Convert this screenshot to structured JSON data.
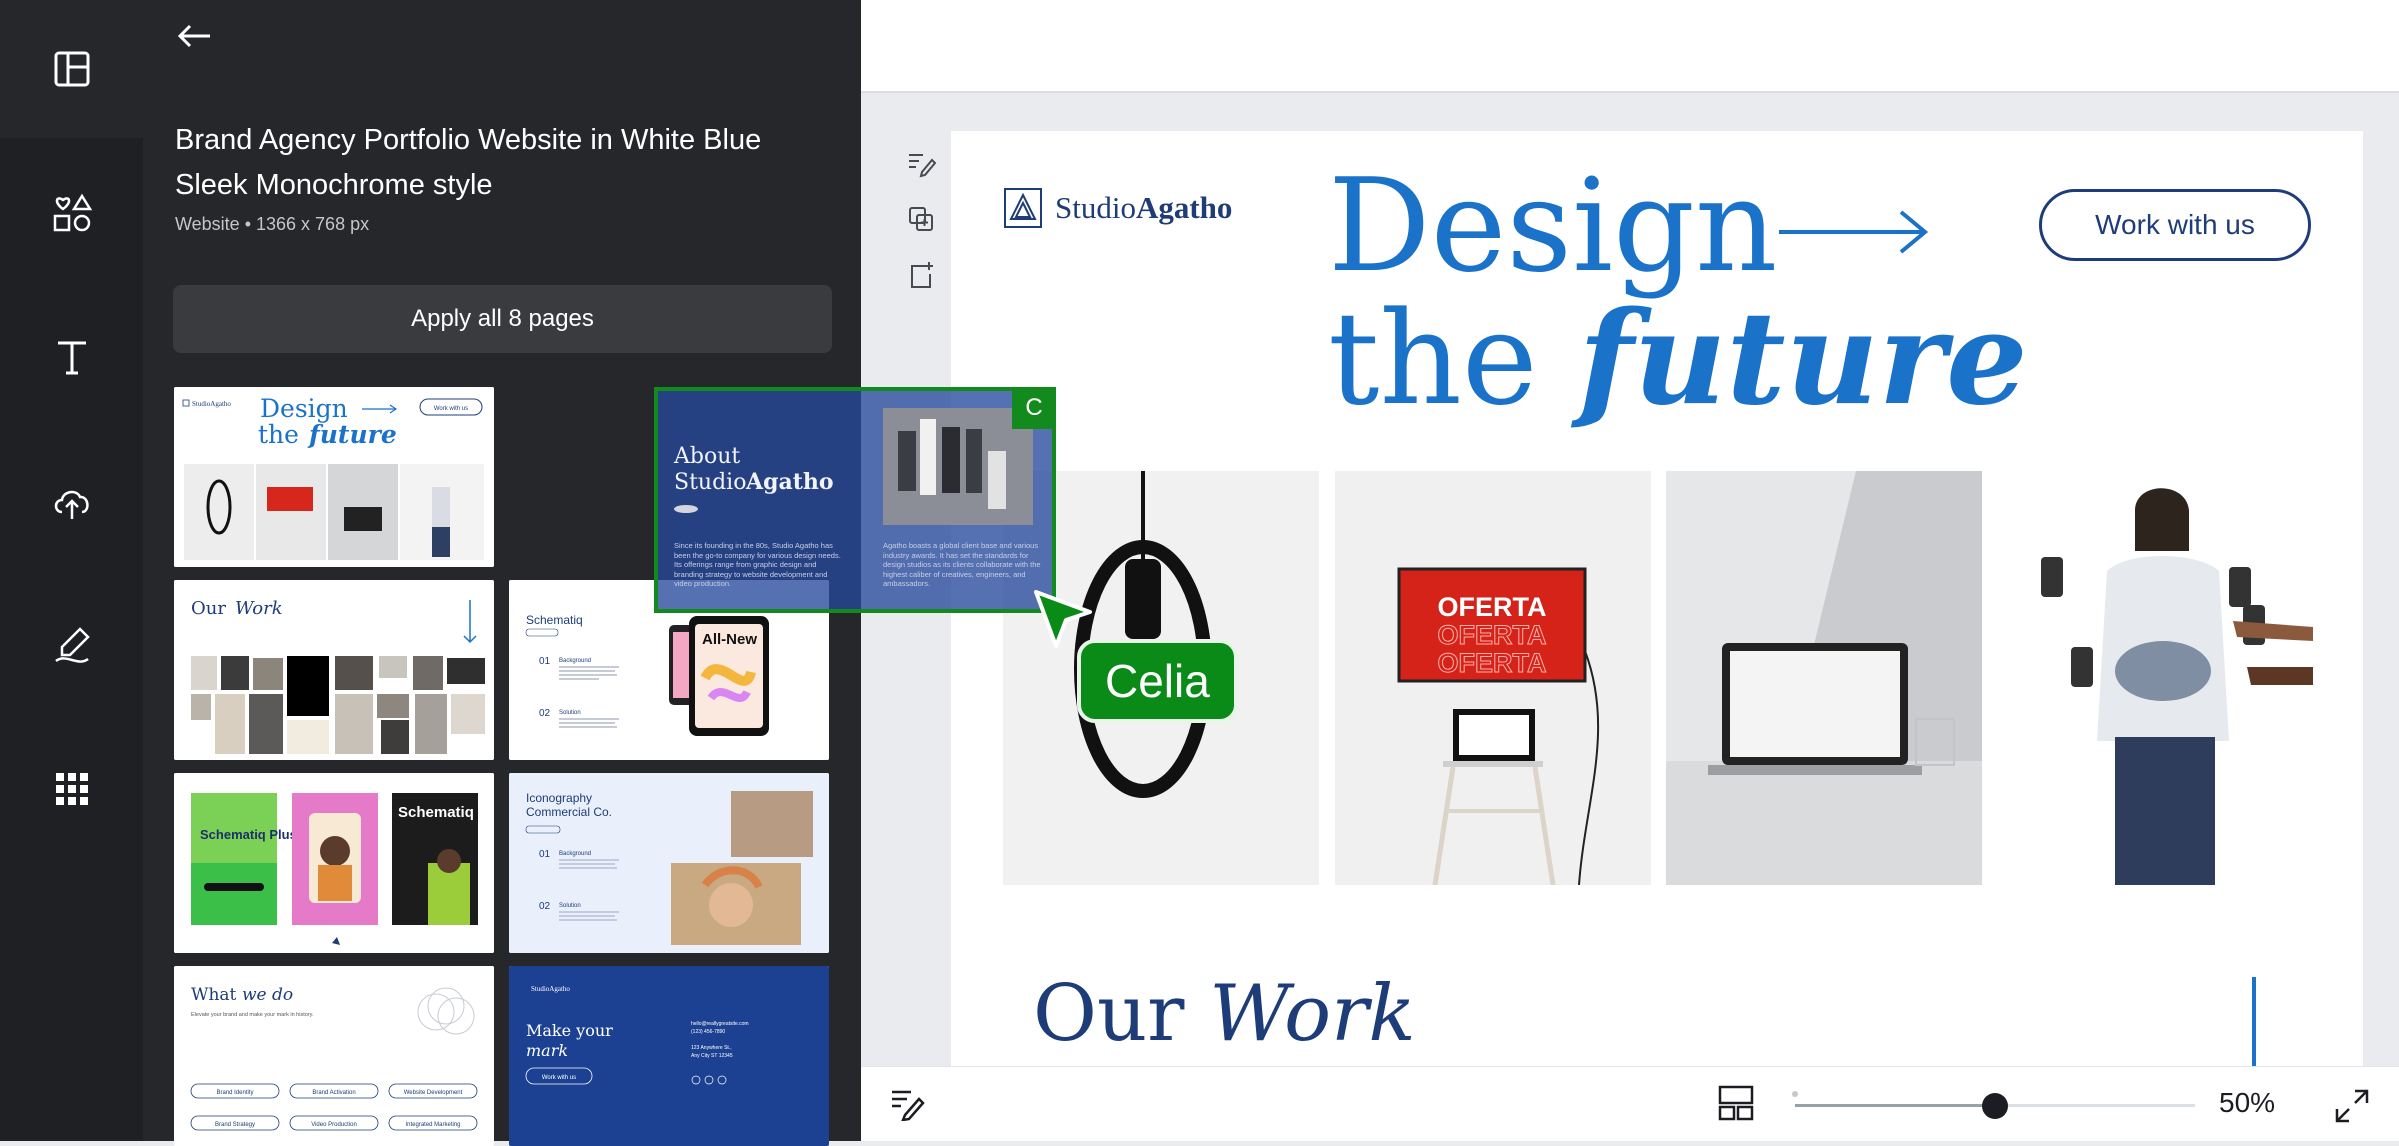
{
  "rail": {
    "items": [
      {
        "name": "design"
      },
      {
        "name": "elements"
      },
      {
        "name": "text"
      },
      {
        "name": "uploads"
      },
      {
        "name": "draw"
      },
      {
        "name": "apps"
      }
    ]
  },
  "panel": {
    "title": "Brand Agency Portfolio Website in White Blue Sleek Monochrome style",
    "meta": "Website • 1366 x 768 px",
    "apply_label": "Apply all 8 pages"
  },
  "thumbs": {
    "t1": {
      "brand": "StudioAgatho",
      "title1": "Design",
      "title2_a": "the ",
      "title2_b": "future",
      "button": "Work with us"
    },
    "t3": {
      "title_a": "Our ",
      "title_b": "Work"
    },
    "t4": {
      "title": "Schematiq",
      "step1": "01",
      "step1_label": "Background",
      "step2": "02",
      "step2_label": "Solution",
      "device_text": "All-New"
    },
    "t5": {
      "card1": "Schematiq Plus+",
      "card2": "Schematiq Plus+"
    },
    "t6": {
      "title": "Iconography Commercial Co.",
      "step1": "01",
      "step1_label": "Background",
      "step2": "02",
      "step2_label": "Solution"
    },
    "t7": {
      "title_a": "What ",
      "title_b": "we do",
      "sub": "Elevate your brand and make your mark in history.",
      "pills": [
        "Brand Identity",
        "Brand Activation",
        "Website Development",
        "Brand Strategy",
        "Video Production",
        "Integrated Marketing"
      ]
    },
    "t8": {
      "brand": "StudioAgatho",
      "title_a": "Make your",
      "title_b": "mark",
      "button": "Work with us",
      "email": "hello@reallygreatsite.com",
      "phone": "(123) 456-7890",
      "address1": "123 Anywhere St.,",
      "address2": "Any City ST 12345"
    }
  },
  "ghost": {
    "title_a": "About",
    "title_b": "Studio",
    "title_c": "Agatho",
    "badge": "C",
    "para1": "Since its founding in the 80s, Studio Agatho has been the go-to company for various design needs. Its offerings range from graphic design and branding strategy to website development and video production.",
    "para2": "Agatho boasts a global client base and various industry awards. It has set the standards for design studios as its clients collaborate with the highest caliber of creatives, engineers, and ambassadors."
  },
  "collaborator": {
    "name": "Celia",
    "color": "#0a8a17"
  },
  "canvas": {
    "brand_a": "Studio",
    "brand_b": "Agatho",
    "hero_line1": "Design",
    "hero_line2_a": "the ",
    "hero_line2_b": "future",
    "cta": "Work with us",
    "oferta": [
      "OFERTA",
      "OFERTA",
      "OFERTA"
    ],
    "section_a": "Our ",
    "section_b": "Work"
  },
  "bottombar": {
    "zoom_label": "50%",
    "zoom_value": 0.5
  },
  "colors": {
    "accent_blue": "#1a72c9",
    "navy": "#1e3d78",
    "collab_green": "#0a8a17",
    "panel_bg": "#26272b"
  }
}
